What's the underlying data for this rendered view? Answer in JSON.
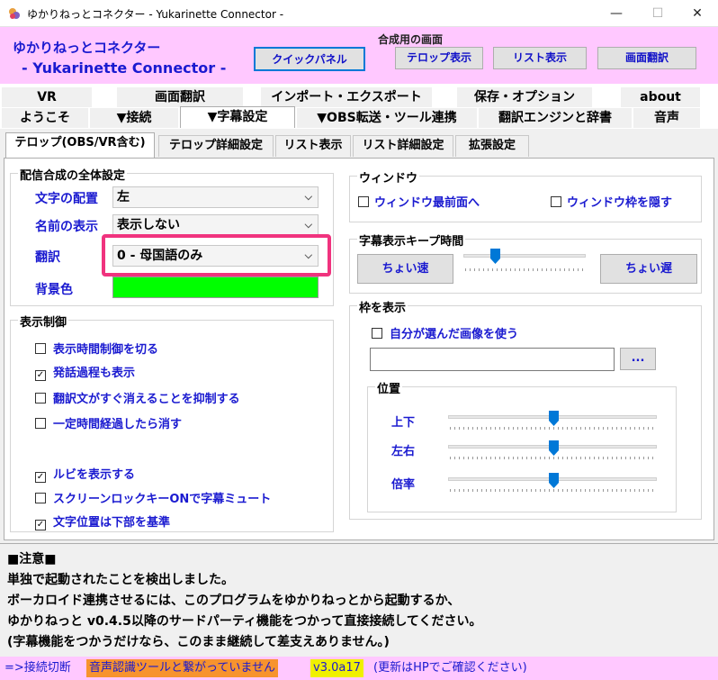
{
  "window": {
    "title": "ゆかりねっとコネクター - Yukarinette Connector -",
    "min_glyph": "—",
    "max_glyph": "☐",
    "close_glyph": "✕"
  },
  "header": {
    "app_name_jp": "ゆかりねっとコネクター",
    "app_name_en": "- Yukarinette Connector -",
    "quick_panel": "クイックパネル",
    "group_label": "合成用の画面",
    "telop_view": "テロップ表示",
    "list_view": "リスト表示",
    "screen_translate": "画面翻訳"
  },
  "tabs": {
    "row1": [
      "VR",
      "画面翻訳",
      "インポート・エクスポート",
      "保存・オプション",
      "about"
    ],
    "row2": [
      "ようこそ",
      "▼接続",
      "▼字幕設定",
      "▼OBS転送・ツール連携",
      "翻訳エンジンと辞書",
      "音声"
    ],
    "active_row2_index": 2
  },
  "subtabs": [
    "テロップ(OBS/VR含む)",
    "テロップ詳細設定",
    "リスト表示",
    "リスト詳細設定",
    "拡張設定"
  ],
  "overall": {
    "legend": "配信合成の全体設定",
    "text_align_label": "文字の配置",
    "text_align_value": "左",
    "name_display_label": "名前の表示",
    "name_display_value": "表示しない",
    "translate_label": "翻訳",
    "translate_value": "0 - 母国語のみ",
    "bg_color_label": "背景色",
    "bg_color": "#00ff00"
  },
  "display_control": {
    "legend": "表示制御",
    "items": [
      {
        "label": "表示時間制御を切る",
        "checked": false
      },
      {
        "label": "発話過程も表示",
        "checked": true
      },
      {
        "label": "翻訳文がすぐ消えることを抑制する",
        "checked": false
      },
      {
        "label": "一定時間経過したら消す",
        "checked": false
      },
      {
        "label": "ルビを表示する",
        "checked": true
      },
      {
        "label": "スクリーンロックキーONで字幕ミュート",
        "checked": false
      },
      {
        "label": "文字位置は下部を基準",
        "checked": true
      }
    ]
  },
  "window_group": {
    "legend": "ウィンドウ",
    "topmost": "ウィンドウ最前面へ",
    "hide_frame": "ウィンドウ枠を隠す"
  },
  "keep_time": {
    "legend": "字幕表示キープ時間",
    "faster": "ちょい速",
    "slower": "ちょい遅",
    "level": 0.25
  },
  "frame_display": {
    "legend": "枠を表示",
    "use_own_image": "自分が選んだ画像を使う",
    "browse": "...",
    "position_legend": "位置",
    "vertical_label": "上下",
    "horizontal_label": "左右",
    "scale_label": "倍率",
    "vertical_level": 0.5,
    "horizontal_level": 0.5,
    "scale_level": 0.5
  },
  "notice": {
    "heading": "■注意■",
    "lines": [
      "単独で起動されたことを検出しました。",
      "ボーカロイド連携させるには、このプログラムをゆかりねっとから起動するか、",
      "ゆかりねっと v0.4.5以降のサードパーティ機能をつかって直接接続してください。",
      "(字幕機能をつかうだけなら、このまま継続して差支えありません。)"
    ]
  },
  "status": {
    "disconnect": "=>接続切断",
    "voice_tool": "音声認識ツールと繋がっていません",
    "version": "v3.0a17",
    "update_hint": "(更新はHPでご確認ください)"
  },
  "colors": {
    "accent_blue": "#1a1ad0",
    "header_pink": "#ffc8ff",
    "highlight_pink": "#f0337e",
    "slider_blue": "#0078d7",
    "status_orange": "#f7932e",
    "status_yellow": "#f0f000"
  }
}
